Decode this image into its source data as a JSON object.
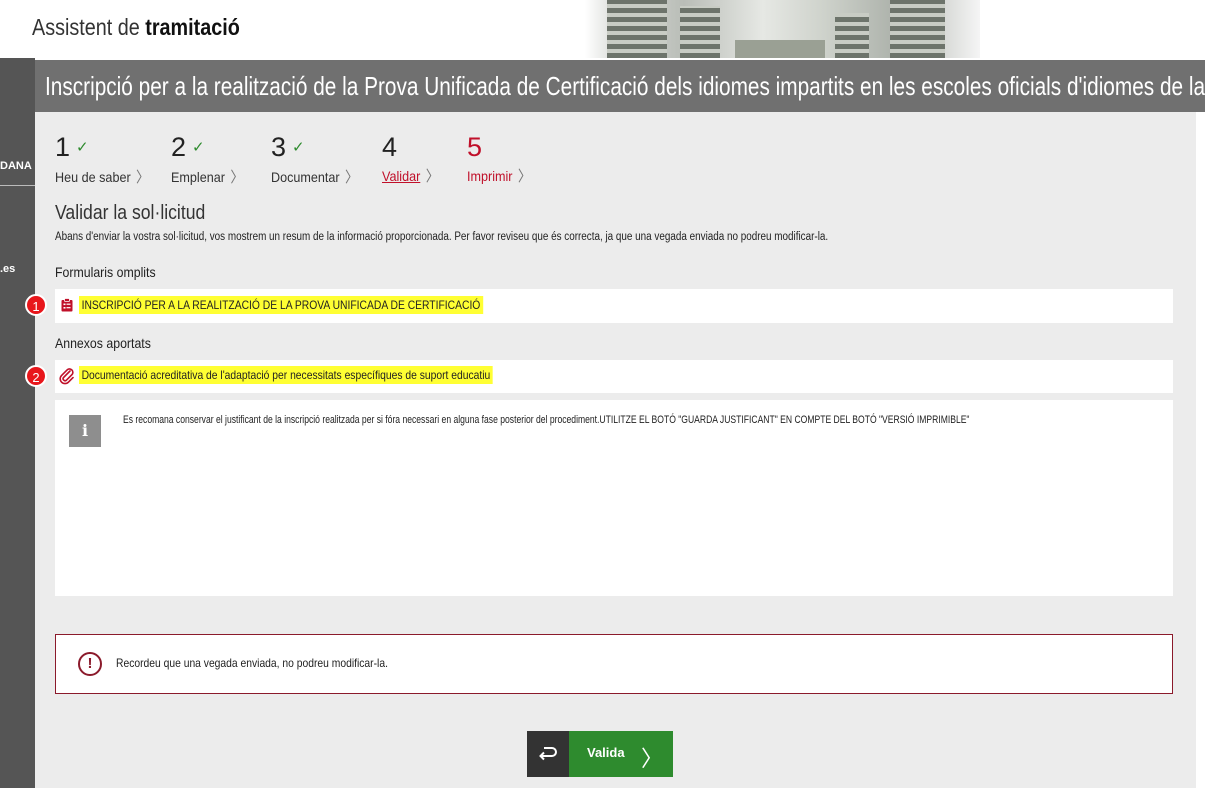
{
  "header": {
    "title_prefix": "Assistent de",
    "title_bold": "tramitació"
  },
  "left_strip": {
    "label_1": "DANA",
    "label_2": ".es"
  },
  "procedure": {
    "title": "Inscripció per a la realització de la Prova Unificada de Certificació dels idiomes impartits en les escoles oficials d'idiomes de la Comunitat Valenciana"
  },
  "steps": [
    {
      "number": "1",
      "label": "Heu de saber",
      "state": "done"
    },
    {
      "number": "2",
      "label": "Emplenar",
      "state": "done"
    },
    {
      "number": "3",
      "label": "Documentar",
      "state": "done"
    },
    {
      "number": "4",
      "label": "Validar",
      "state": "active"
    },
    {
      "number": "5",
      "label": "Imprimir",
      "state": "pending"
    }
  ],
  "section": {
    "title": "Validar la sol·licitud",
    "description": "Abans d'enviar la vostra sol·licitud, vos mostrem un resum de la informació proporcionada. Per favor reviseu que és correcta, ja que una vegada enviada no podreu modificar-la."
  },
  "forms": {
    "label": "Formularis omplits",
    "item": "INSCRIPCIÓ PER A LA REALITZACIÓ DE LA PROVA UNIFICADA DE CERTIFICACIÓ",
    "icon": "clipboard-icon",
    "badge": "1"
  },
  "annexes": {
    "label": "Annexos aportats",
    "item": "Documentació acreditativa de l'adaptació per necessitats específiques de suport educatiu",
    "icon": "paperclip-icon",
    "badge": "2"
  },
  "info": {
    "icon_glyph": "i",
    "text": "Es recomana conservar el justificant de la inscripció realitzada per si fóra necessari en alguna fase posterior del procediment.UTILITZE EL BOTÓ \"GUARDA JUSTIFICANT\" EN COMPTE DEL BOTÓ \"VERSIÓ IMPRIMIBLE\""
  },
  "warning": {
    "icon_glyph": "!",
    "text": "Recordeu que una vegada enviada, no podreu modificar-la."
  },
  "actions": {
    "back_icon": "return-arrow-icon",
    "valida_label": "Valida"
  },
  "colors": {
    "accent_red": "#c0102a",
    "check_green": "#2e8b2e",
    "highlight_yellow": "#ffff33",
    "badge_red": "#e8161b",
    "warning_border": "#8b1a2b"
  }
}
